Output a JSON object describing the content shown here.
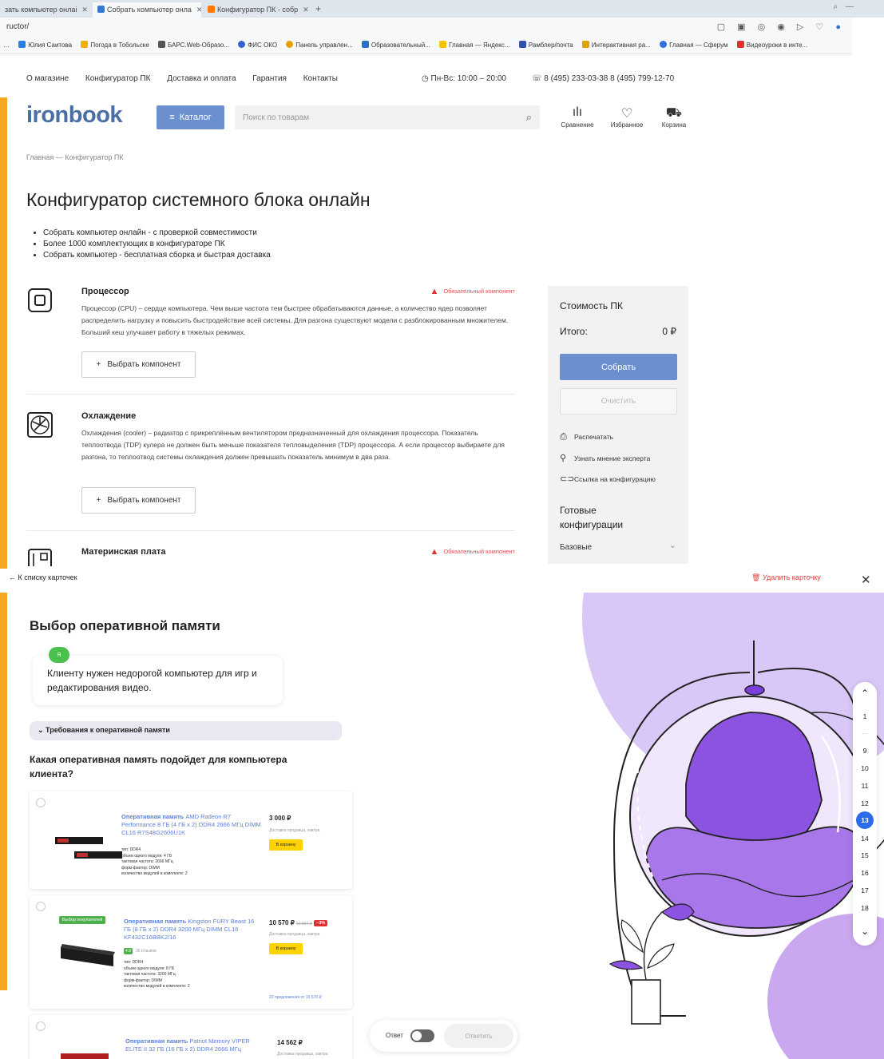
{
  "browser": {
    "tabs": [
      {
        "label": "зать компьютер онлаі",
        "color": "#c0c8d0"
      },
      {
        "label": "Собрать компьютер онла",
        "color": "#3b77d0"
      },
      {
        "label": "Конфигуратор ПК - собр",
        "color": "#ff7a00"
      }
    ],
    "new_tab": "+",
    "url": "ructor/",
    "bookmarks": [
      {
        "label": "Юлия Саитова",
        "color": "#2a7de1"
      },
      {
        "label": "Погода в Тобольске",
        "color": "#f0b000"
      },
      {
        "label": "БАРС.Web-Образо...",
        "color": "#555555"
      },
      {
        "label": "ФИС ОКО",
        "color": "#3366cc"
      },
      {
        "label": "Панель управлен...",
        "color": "#e8a000"
      },
      {
        "label": "Образовательный...",
        "color": "#3070c0"
      },
      {
        "label": "Главная — Яндекс...",
        "color": "#f5c400"
      },
      {
        "label": "Рамблер/почта",
        "color": "#3050b0"
      },
      {
        "label": "Интерактивная ра...",
        "color": "#e0a000"
      },
      {
        "label": "Главная — Сферум",
        "color": "#3070e0"
      },
      {
        "label": "Видеоуроки в инте...",
        "color": "#e03030"
      }
    ]
  },
  "site": {
    "topnav": [
      "О магазине",
      "Конфигуратор ПК",
      "Доставка и оплата",
      "Гарантия",
      "Контакты"
    ],
    "hours": "Пн-Вс: 10:00 – 20:00",
    "phones": "8 (495) 233-03-38   8 (495) 799-12-70",
    "logo": "ironbook",
    "catalog": "Каталог",
    "search_placeholder": "Поиск по товарам",
    "header_icons": [
      "Сравнение",
      "Избранное",
      "Корзина"
    ],
    "breadcrumb": "Главная   —   Конфигуратор ПК",
    "title": "Конфигуратор системного блока онлайн",
    "bullets": [
      "Собрать компьютер онлайн - с проверкой совместимости",
      "Более 1000 комплектующих в конфигураторе ПК",
      "Собрать компьютер - бесплатная сборка и быстрая доставка"
    ],
    "components": [
      {
        "title": "Процессор",
        "required": "Обязательный компонент",
        "desc": "Процессор (CPU) – сердце компьютера. Чем выше частота тем быстрее обрабатываются данные, а количество ядер позволяет распределить нагрузку и повысить быстродействие всей системы. Для разгона существуют модели с разблокированным множителем. Больший кеш улучшает работу в тяжелых режимах.",
        "button": "Выбрать компонент"
      },
      {
        "title": "Охлаждение",
        "required": "",
        "desc": "Охлаждения (cooler) – радиатор с прикреплённым вентилятором предназначенный для охлаждения процессора. Показатель теплоотвода (TDP) кулера не должен быть меньше показателя тепловыделения (TDP) процессора. А если процессор выбираете для разгона, то теплоотвод системы охлаждения должен превышать показатель минимум в два раза.",
        "button": "Выбрать компонент"
      },
      {
        "title": "Материнская плата",
        "required": "Обязательный компонент"
      }
    ],
    "cost": {
      "title": "Стоимость ПК",
      "total_label": "Итого:",
      "total_value": "0 ₽",
      "build": "Собрать",
      "clear": "Очистить",
      "links": [
        "Распечатать",
        "Узнать мнение эксперта",
        "Ссылка на конфигурацию"
      ],
      "ready_title": "Готовые конфигурации",
      "ready_select": "Базовые"
    }
  },
  "task": {
    "back": "← К списку карточек",
    "delete": "Удалить карточку",
    "title": "Выбор оперативной памяти",
    "avatar": "Я",
    "message": "Клиенту нужен недорогой компьютер для игр и редактирования видео.",
    "requirements": "Требования к оперативной памяти",
    "question": "Какая оперативная память подойдет для компьютера клиента?",
    "products": [
      {
        "name_bold": "Оперативная память",
        "name": " AMD Radeon R7 Performance 8 ГБ (4 ГБ x 2) DDR4 2666 МГц DIMM CL16 R7S48G2606U1K",
        "price": "3 000 ₽",
        "delivery": "Доставка продавца, завтра",
        "cart": "В корзину",
        "specs": [
          "тип: DDR4",
          "объем одного модуля: 4 ГБ",
          "тактовая частота: 2666 МГц",
          "форм-фактор: DIMM",
          "количество модулей в комплекте: 2"
        ]
      },
      {
        "badge": "Выбор покупателей",
        "name_bold": "Оперативная память",
        "name": " Kingston FURY Beast 16 ГБ (8 ГБ x 2) DDR4 3200 МГц DIMM CL16 KF432C16BBK2/16",
        "price": "10 570 ₽",
        "old_price": "10 867 ₽",
        "discount": "−3%",
        "delivery": "Доставка продавца, завтра",
        "cart": "В корзину",
        "rating": "4.8",
        "reviews": "36 отзывов",
        "specs": [
          "тип: DDR4",
          "объем одного модуля: 8 ГБ",
          "тактовая частота: 3200 МГц",
          "форм-фактор: DIMM",
          "количество модулей в комплекте: 2"
        ],
        "offers": "22 предложения от 10 570 ₽"
      },
      {
        "name_bold": "Оперативная память",
        "name": " Patriot Memory VIPER ELITE II 32 ГБ (16 ГБ x 2) DDR4 2666 МГц",
        "price": "14 562 ₽",
        "delivery": "Доставка продавца, завтра"
      }
    ],
    "answer_label": "Ответ",
    "answer_button": "Ответить",
    "pager": {
      "items": [
        "1",
        "…",
        "9",
        "10",
        "11",
        "12",
        "13",
        "14",
        "15",
        "16",
        "17",
        "18"
      ],
      "current": "13"
    }
  }
}
